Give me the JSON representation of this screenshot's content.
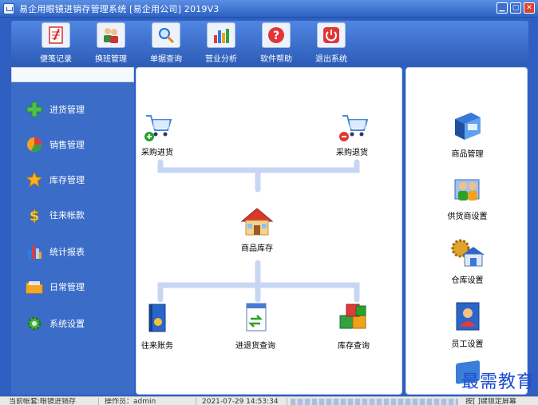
{
  "window": {
    "title": "易企用眼镜进销存管理系统 [易企用公司] 2019V3",
    "controls": [
      "minimize-icon",
      "maximize-icon",
      "close-icon"
    ]
  },
  "toolbar": {
    "items": [
      {
        "label": "便笺记录",
        "icon": "notepad-icon"
      },
      {
        "label": "换班管理",
        "icon": "users-icon"
      },
      {
        "label": "单据查询",
        "icon": "magnifier-icon"
      },
      {
        "label": "营业分析",
        "icon": "bar-chart-icon"
      },
      {
        "label": "软件帮助",
        "icon": "help-icon"
      },
      {
        "label": "退出系统",
        "icon": "power-icon"
      }
    ]
  },
  "sidebar": {
    "items": [
      {
        "label": "进货管理",
        "icon": "plus-icon"
      },
      {
        "label": "销售管理",
        "icon": "pie-icon"
      },
      {
        "label": "库存管理",
        "icon": "star-icon"
      },
      {
        "label": "往来帐款",
        "icon": "dollar-icon"
      },
      {
        "label": "统计报表",
        "icon": "bars-icon"
      },
      {
        "label": "日常管理",
        "icon": "folder-icon"
      },
      {
        "label": "系统设置",
        "icon": "gear-icon"
      }
    ]
  },
  "flow": {
    "purchase": "采购进货",
    "purchase_return": "采购退货",
    "inventory": "商品库存",
    "accounts": "往来账务",
    "inout_query": "进退货查询",
    "stock_query": "库存查询"
  },
  "rightpanel": {
    "items": [
      {
        "label": "商品管理",
        "icon": "product-icon"
      },
      {
        "label": "供货商设置",
        "icon": "supplier-icon"
      },
      {
        "label": "仓库设置",
        "icon": "warehouse-icon"
      },
      {
        "label": "员工设置",
        "icon": "employee-icon"
      }
    ]
  },
  "status": {
    "current_account": "当前帐套:眼镜进销存",
    "operator": "操作员：admin",
    "datetime": "2021-07-29 14:53:34",
    "hint": "按[ ]键锁定屏幕"
  },
  "watermark": "最需教育",
  "colors": {
    "accent": "#2f5fc1",
    "sidebar": "#3a6cc8",
    "connector": "#c7d7f3"
  }
}
